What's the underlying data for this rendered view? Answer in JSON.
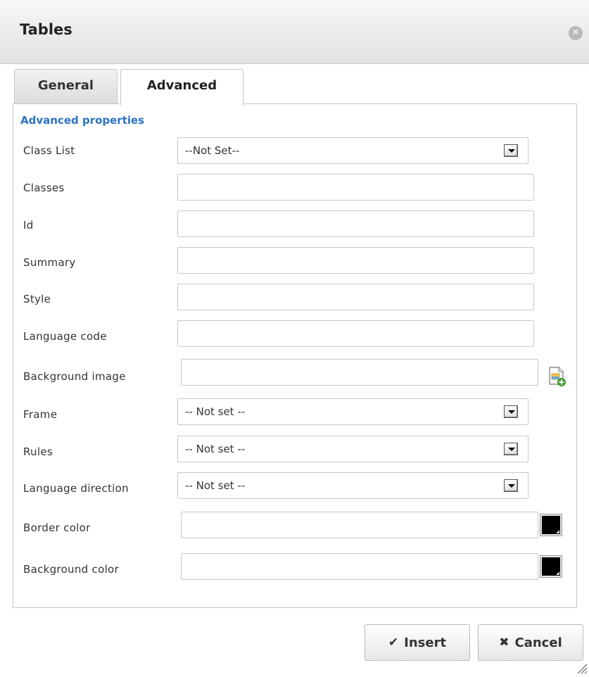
{
  "dialog": {
    "title": "Tables"
  },
  "tabs": [
    {
      "label": "General",
      "active": false
    },
    {
      "label": "Advanced",
      "active": true
    }
  ],
  "section": {
    "legend": "Advanced properties"
  },
  "fields": {
    "class_list": {
      "label": "Class List",
      "value": "--Not Set--"
    },
    "classes": {
      "label": "Classes",
      "value": ""
    },
    "id": {
      "label": "Id",
      "value": ""
    },
    "summary": {
      "label": "Summary",
      "value": ""
    },
    "style": {
      "label": "Style",
      "value": ""
    },
    "language_code": {
      "label": "Language code",
      "value": ""
    },
    "background_image": {
      "label": "Background image",
      "value": ""
    },
    "frame": {
      "label": "Frame",
      "value": "-- Not set --"
    },
    "rules": {
      "label": "Rules",
      "value": "-- Not set --"
    },
    "language_direction": {
      "label": "Language direction",
      "value": "-- Not set --"
    },
    "border_color": {
      "label": "Border color",
      "value": ""
    },
    "background_color": {
      "label": "Background color",
      "value": ""
    }
  },
  "buttons": {
    "insert": {
      "label": "Insert",
      "icon": "checkmark-icon"
    },
    "cancel": {
      "label": "Cancel",
      "icon": "x-icon"
    }
  },
  "colors": {
    "legend": "#2b72c4",
    "swatch": "#000000"
  }
}
